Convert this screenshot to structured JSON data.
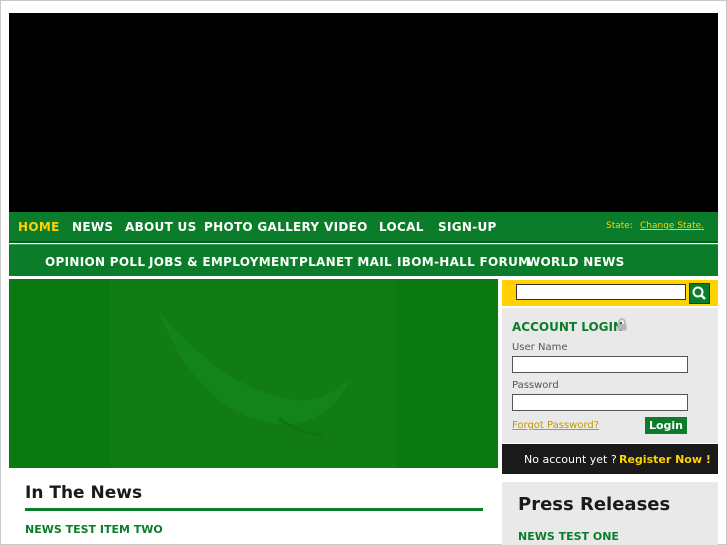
{
  "nav_primary": {
    "items": [
      {
        "label": "HOME",
        "active": true
      },
      {
        "label": "NEWS"
      },
      {
        "label": "ABOUT US"
      },
      {
        "label": "PHOTO GALLERY"
      },
      {
        "label": "VIDEO"
      },
      {
        "label": "LOCAL"
      },
      {
        "label": "SIGN-UP"
      }
    ],
    "state_label": "State:",
    "change_state": "Change State."
  },
  "nav_secondary": {
    "items": [
      {
        "label": "OPINION POLL"
      },
      {
        "label": "JOBS & EMPLOYMENT"
      },
      {
        "label": "PLANET MAIL"
      },
      {
        "label": "IBOM-HALL FORUM"
      },
      {
        "label": "WORLD NEWS"
      }
    ]
  },
  "login": {
    "title": "ACCOUNT LOGIN",
    "username_label": "User Name",
    "password_label": "Password",
    "forgot": "Forgot Password?",
    "button": "Login"
  },
  "register": {
    "question": "No account yet ?",
    "link": "Register Now !"
  },
  "news": {
    "heading": "In The News",
    "items": [
      "NEWS TEST ITEM TWO"
    ]
  },
  "press": {
    "heading": "Press Releases",
    "items": [
      "NEWS TEST ONE"
    ]
  },
  "colors": {
    "brand_green": "#0b7d2a",
    "accent_yellow": "#ffd200"
  }
}
